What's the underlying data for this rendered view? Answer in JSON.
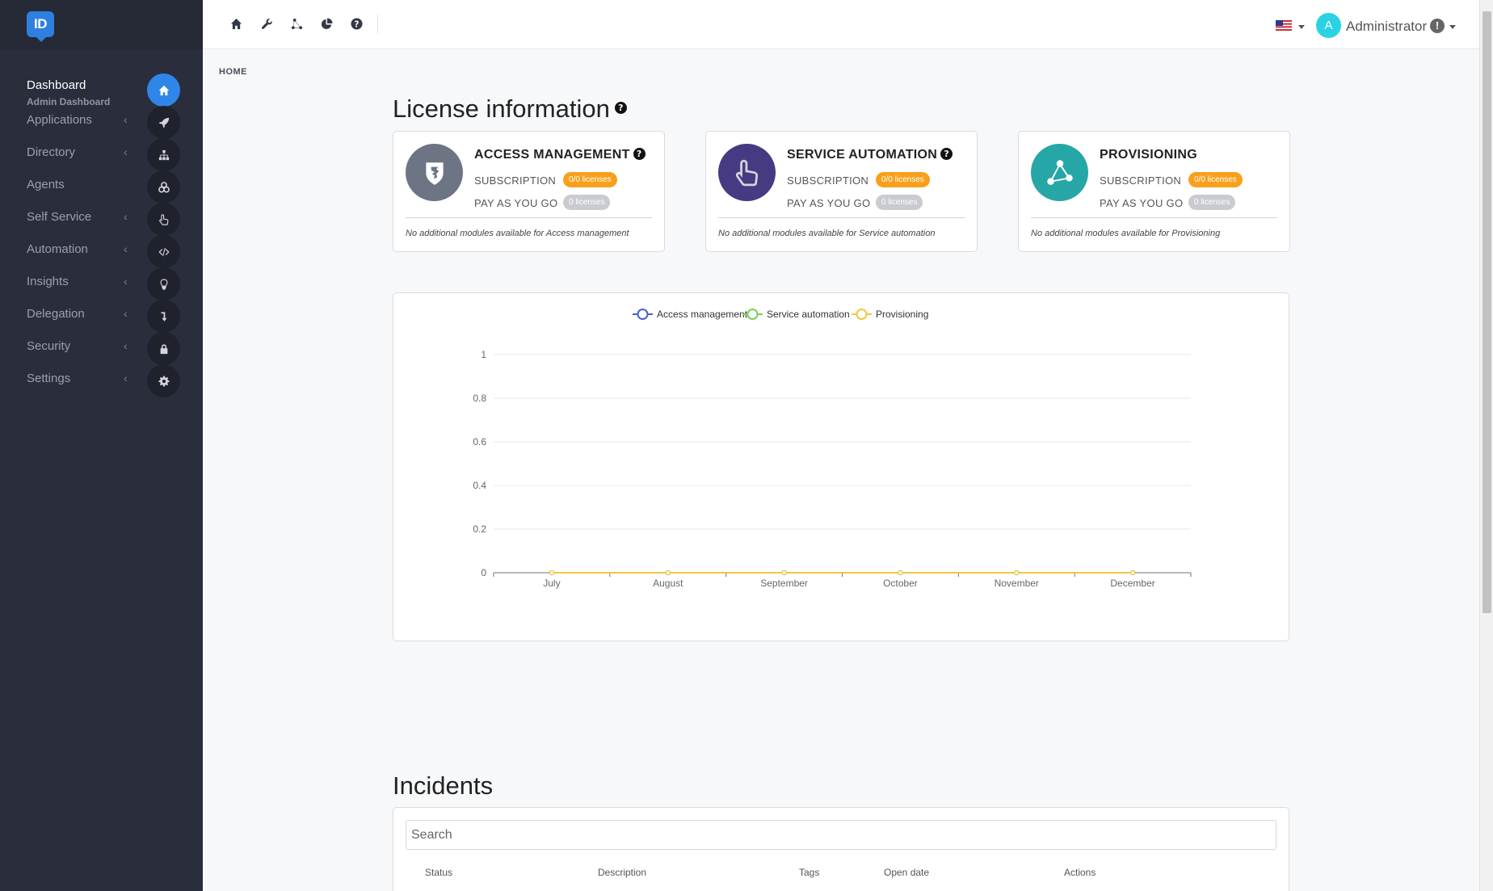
{
  "app": {
    "logo_text": "ID"
  },
  "sidebar": {
    "items": [
      {
        "label": "Dashboard",
        "sub": "Admin Dashboard",
        "icon": "home-icon",
        "active": true
      },
      {
        "label": "Applications",
        "icon": "rocket-icon"
      },
      {
        "label": "Directory",
        "icon": "sitemap-icon"
      },
      {
        "label": "Agents",
        "icon": "cogs-icon"
      },
      {
        "label": "Self Service",
        "icon": "hand-pointer-icon"
      },
      {
        "label": "Automation",
        "icon": "code-icon"
      },
      {
        "label": "Insights",
        "icon": "lightbulb-icon"
      },
      {
        "label": "Delegation",
        "icon": "level-down-icon"
      },
      {
        "label": "Security",
        "icon": "lock-icon"
      },
      {
        "label": "Settings",
        "icon": "gear-icon"
      }
    ],
    "chevron": "‹"
  },
  "topbar": {
    "icons": [
      "home-icon",
      "wrench-icon",
      "share-nodes-icon",
      "pie-chart-icon",
      "help-icon"
    ],
    "user_initial": "A",
    "user_name": "Administrator",
    "warning": "!"
  },
  "breadcrumb": "HOME",
  "license": {
    "title": "License information",
    "help": "?",
    "cards": [
      {
        "title": "ACCESS MANAGEMENT",
        "has_help": true,
        "color": "#6d7585",
        "icon": "shield-icon",
        "subscription_label": "SUBSCRIPTION",
        "subscription_value": "0/0 licenses",
        "payg_label": "PAY AS YOU GO",
        "payg_value": "0 licenses",
        "note": "No additional modules available for Access management"
      },
      {
        "title": "SERVICE AUTOMATION",
        "has_help": true,
        "color": "#463a82",
        "icon": "hand-pointer-icon",
        "subscription_label": "SUBSCRIPTION",
        "subscription_value": "0/0 licenses",
        "payg_label": "PAY AS YOU GO",
        "payg_value": "0 licenses",
        "note": "No additional modules available for Service automation"
      },
      {
        "title": "PROVISIONING",
        "has_help": false,
        "color": "#27a6a8",
        "icon": "share-nodes-icon",
        "subscription_label": "SUBSCRIPTION",
        "subscription_value": "0/0 licenses",
        "payg_label": "PAY AS YOU GO",
        "payg_value": "0 licenses",
        "note": "No additional modules available for Provisioning"
      }
    ]
  },
  "chart_data": {
    "type": "line",
    "categories": [
      "July",
      "August",
      "September",
      "October",
      "November",
      "December"
    ],
    "series": [
      {
        "name": "Access management",
        "color": "#4a62c4",
        "values": [
          0,
          0,
          0,
          0,
          0,
          0
        ]
      },
      {
        "name": "Service automation",
        "color": "#7ccf5b",
        "values": [
          0,
          0,
          0,
          0,
          0,
          0
        ]
      },
      {
        "name": "Provisioning",
        "color": "#f5c542",
        "values": [
          0,
          0,
          0,
          0,
          0,
          0
        ]
      }
    ],
    "y_ticks": [
      "0",
      "0.2",
      "0.4",
      "0.6",
      "0.8",
      "1"
    ],
    "ylim": [
      0,
      1
    ],
    "grid": true,
    "legend": "top-center"
  },
  "incidents": {
    "title": "Incidents",
    "search_placeholder": "Search",
    "columns": [
      "Status",
      "Description",
      "Tags",
      "Open date",
      "Actions"
    ]
  }
}
